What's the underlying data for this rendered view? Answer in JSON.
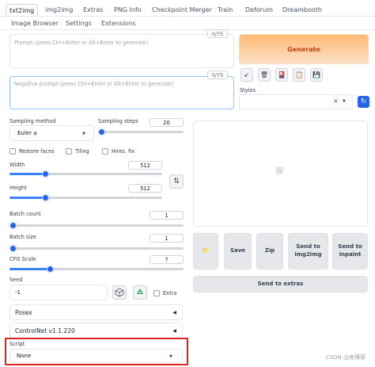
{
  "tabs": {
    "items": [
      {
        "label": "txt2img",
        "active": true
      },
      {
        "label": "img2img"
      },
      {
        "label": "Extras"
      },
      {
        "label": "PNG Info"
      },
      {
        "label": "Checkpoint Merger"
      },
      {
        "label": "Train"
      },
      {
        "label": "Deforum"
      },
      {
        "label": "Dreambooth"
      },
      {
        "label": "Image Browser"
      },
      {
        "label": "Settings"
      },
      {
        "label": "Extensions"
      }
    ]
  },
  "prompt": {
    "placeholder": "Prompt (press Ctrl+Enter or Alt+Enter to generate)",
    "token_count": "0/75",
    "value": ""
  },
  "negative_prompt": {
    "placeholder": "Negative prompt (press Ctrl+Enter or Alt+Enter to generate)",
    "token_count": "0/75",
    "value": ""
  },
  "generate": {
    "label": "Generate"
  },
  "tools": {
    "icons": [
      "arrow-diagonal-icon",
      "trash-icon",
      "red-card-icon",
      "clipboard-icon",
      "floppy-disk-icon"
    ],
    "glyphs": [
      "↙",
      "🗑",
      "🎴",
      "📋",
      "💾"
    ]
  },
  "styles": {
    "label": "Styles",
    "clear": "×",
    "refresh": "↻"
  },
  "sampling": {
    "method_label": "Sampling method",
    "method_value": "Euler a",
    "steps_label": "Sampling steps",
    "steps_value": "20",
    "steps_min": 1,
    "steps_max": 150
  },
  "options": {
    "restore_faces": "Restore faces",
    "tiling": "Tiling",
    "hires_fix": "Hires. fix"
  },
  "width": {
    "label": "Width",
    "value": "512",
    "fraction": 0.22
  },
  "height": {
    "label": "Height",
    "value": "512",
    "fraction": 0.22
  },
  "swap": {
    "glyph": "⇅"
  },
  "batch_count": {
    "label": "Batch count",
    "value": "1"
  },
  "batch_size": {
    "label": "Batch size",
    "value": "1"
  },
  "cfg_scale": {
    "label": "CFG Scale",
    "value": "7",
    "fraction": 0.22
  },
  "seed": {
    "label": "Seed",
    "value": "-1",
    "extra_label": "Extra"
  },
  "accordions": [
    {
      "label": "Posex",
      "arrow": "◀"
    },
    {
      "label": "ControlNet v1.1.220",
      "arrow": "◀"
    }
  ],
  "script": {
    "label": "Script",
    "value": "None"
  },
  "output": {
    "image_icon": "🖼"
  },
  "actions": {
    "open_folder": "📁",
    "save": "Save",
    "zip": "Zip",
    "send_img2img": "Send to img2img",
    "send_inpaint": "Send to inpaint",
    "send_extras": "Send to extras"
  },
  "watermark": "CSDN @席博客",
  "colors": {
    "accent": "#3b82f6",
    "generate": "#fdba74",
    "highlight": "#dc2626"
  }
}
